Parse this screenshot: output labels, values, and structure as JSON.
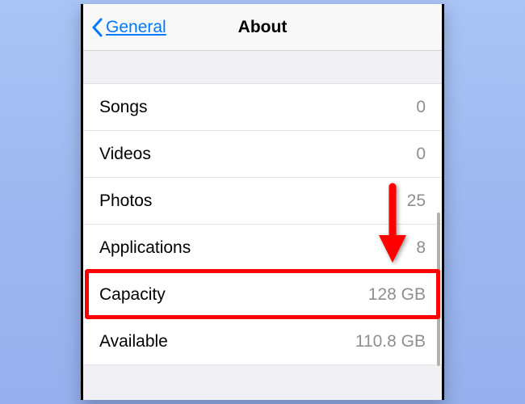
{
  "nav": {
    "back_label": "General",
    "title": "About"
  },
  "rows": [
    {
      "label": "Songs",
      "value": "0"
    },
    {
      "label": "Videos",
      "value": "0"
    },
    {
      "label": "Photos",
      "value": "25"
    },
    {
      "label": "Applications",
      "value": "8"
    },
    {
      "label": "Capacity",
      "value": "128 GB"
    },
    {
      "label": "Available",
      "value": "110.8 GB"
    }
  ],
  "annotation": {
    "highlight_row_index": 4,
    "colors": {
      "highlight": "#ff0000",
      "arrow": "#ff0000"
    }
  }
}
